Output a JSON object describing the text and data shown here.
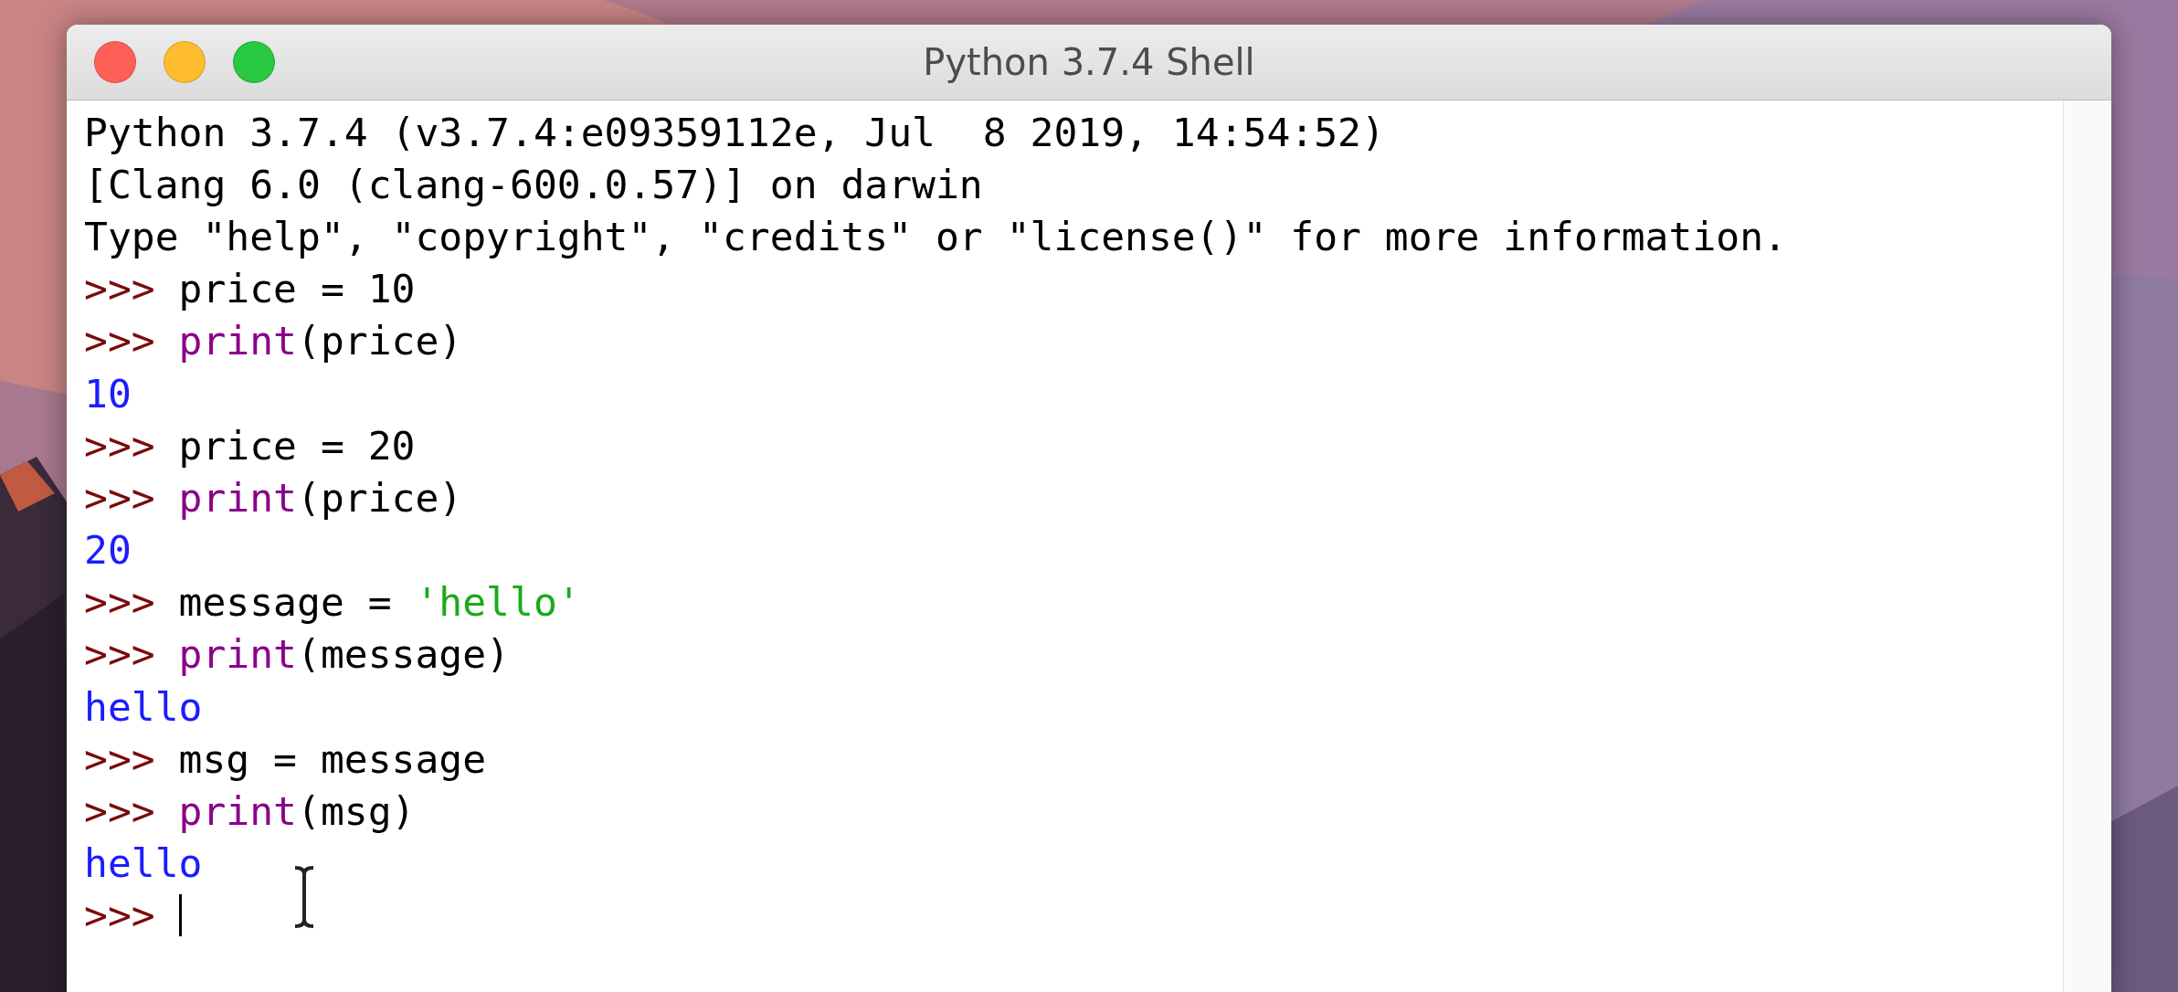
{
  "window": {
    "title": "Python 3.7.4 Shell"
  },
  "shell": {
    "lines": [
      {
        "segments": [
          {
            "kind": "plain",
            "text": "Python 3.7.4 (v3.7.4:e09359112e, Jul  8 2019, 14:54:52)"
          }
        ]
      },
      {
        "segments": [
          {
            "kind": "plain",
            "text": "[Clang 6.0 (clang-600.0.57)] on darwin"
          }
        ]
      },
      {
        "segments": [
          {
            "kind": "plain",
            "text": "Type \"help\", \"copyright\", \"credits\" or \"license()\" for more information."
          }
        ]
      },
      {
        "segments": [
          {
            "kind": "prompt",
            "text": ">>> "
          },
          {
            "kind": "plain",
            "text": "price = 10"
          }
        ]
      },
      {
        "segments": [
          {
            "kind": "prompt",
            "text": ">>> "
          },
          {
            "kind": "builtin",
            "text": "print"
          },
          {
            "kind": "plain",
            "text": "(price)"
          }
        ]
      },
      {
        "segments": [
          {
            "kind": "output",
            "text": "10"
          }
        ]
      },
      {
        "segments": [
          {
            "kind": "prompt",
            "text": ">>> "
          },
          {
            "kind": "plain",
            "text": "price = 20"
          }
        ]
      },
      {
        "segments": [
          {
            "kind": "prompt",
            "text": ">>> "
          },
          {
            "kind": "builtin",
            "text": "print"
          },
          {
            "kind": "plain",
            "text": "(price)"
          }
        ]
      },
      {
        "segments": [
          {
            "kind": "output",
            "text": "20"
          }
        ]
      },
      {
        "segments": [
          {
            "kind": "prompt",
            "text": ">>> "
          },
          {
            "kind": "plain",
            "text": "message = "
          },
          {
            "kind": "string",
            "text": "'hello'"
          }
        ]
      },
      {
        "segments": [
          {
            "kind": "prompt",
            "text": ">>> "
          },
          {
            "kind": "builtin",
            "text": "print"
          },
          {
            "kind": "plain",
            "text": "(message)"
          }
        ]
      },
      {
        "segments": [
          {
            "kind": "output",
            "text": "hello"
          }
        ]
      },
      {
        "segments": [
          {
            "kind": "prompt",
            "text": ">>> "
          },
          {
            "kind": "plain",
            "text": "msg = message"
          }
        ]
      },
      {
        "segments": [
          {
            "kind": "prompt",
            "text": ">>> "
          },
          {
            "kind": "builtin",
            "text": "print"
          },
          {
            "kind": "plain",
            "text": "(msg)"
          }
        ]
      },
      {
        "segments": [
          {
            "kind": "output",
            "text": "hello"
          }
        ]
      },
      {
        "segments": [
          {
            "kind": "prompt",
            "text": ">>> "
          }
        ]
      }
    ]
  }
}
